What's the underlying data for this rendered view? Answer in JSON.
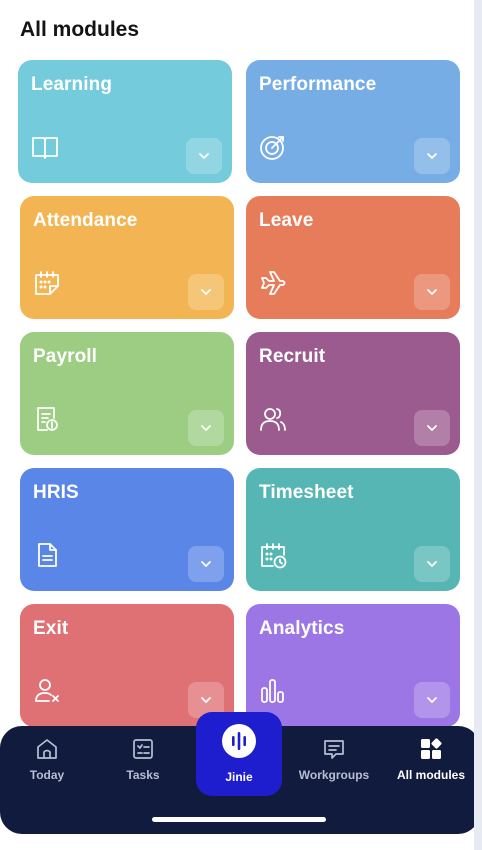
{
  "page": {
    "title": "All modules"
  },
  "modules": [
    {
      "label": "Learning",
      "icon": "book-icon",
      "color": "#74cbdc"
    },
    {
      "label": "Performance",
      "icon": "target-icon",
      "color": "#76ade4"
    },
    {
      "label": "Attendance",
      "icon": "calendar-icon",
      "color": "#f3b553"
    },
    {
      "label": "Leave",
      "icon": "airplane-icon",
      "color": "#e77c5b"
    },
    {
      "label": "Payroll",
      "icon": "payslip-icon",
      "color": "#9ccd83"
    },
    {
      "label": "Recruit",
      "icon": "people-icon",
      "color": "#9b5b8f"
    },
    {
      "label": "HRIS",
      "icon": "document-icon",
      "color": "#5a86e8"
    },
    {
      "label": "Timesheet",
      "icon": "calendar-clock-icon",
      "color": "#55b6b4"
    },
    {
      "label": "Exit",
      "icon": "user-remove-icon",
      "color": "#df7175"
    },
    {
      "label": "Analytics",
      "icon": "bar-chart-icon",
      "color": "#9d76e6"
    }
  ],
  "nav": {
    "items": [
      {
        "label": "Today",
        "icon": "home-icon"
      },
      {
        "label": "Tasks",
        "icon": "checklist-icon"
      },
      {
        "label": "Jinie",
        "icon": "voice-icon"
      },
      {
        "label": "Workgroups",
        "icon": "chat-icon"
      },
      {
        "label": "All modules",
        "icon": "grid-icon"
      }
    ],
    "active": "All modules",
    "background": "#101b3d",
    "accent": "#1f1ecf"
  }
}
